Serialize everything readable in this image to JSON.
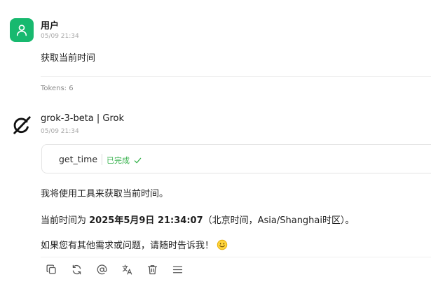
{
  "user_message": {
    "name": "用户",
    "time": "05/09 21:34",
    "text": "获取当前时间",
    "tokens": "Tokens: 6",
    "avatar_color": "#18b96f"
  },
  "assistant_message": {
    "name": "grok-3-beta | Grok",
    "time": "05/09 21:34",
    "tool_call": {
      "name": "get_time",
      "status": "已完成",
      "status_color": "#37b24d"
    },
    "para1": "我将使用工具来获取当前时间。",
    "para2_prefix": "当前时间为 ",
    "para2_bold": "2025年5月9日 21:34:07",
    "para2_suffix": "（北京时间，Asia/Shanghai时区）。",
    "para3": "如果您有其他需求或问题，请随时告诉我！"
  },
  "actions": [
    "copy-icon",
    "refresh-icon",
    "at-icon",
    "translate-icon",
    "delete-icon",
    "menu-icon"
  ]
}
